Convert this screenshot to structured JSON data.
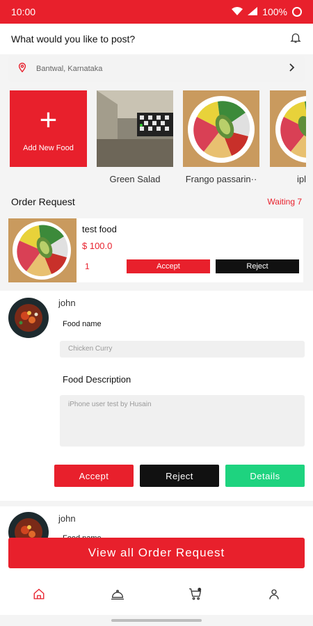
{
  "status_bar": {
    "time": "10:00",
    "battery": "100%"
  },
  "header": {
    "title": "What would you like to post?"
  },
  "location": {
    "text": "Bantwal, Karnataka"
  },
  "add_food": {
    "plus": "+",
    "label": "Add New Food"
  },
  "foods": [
    {
      "name": "Green Salad"
    },
    {
      "name": "Frango passarin··"
    },
    {
      "name": "ipl"
    }
  ],
  "order_section": {
    "title": "Order Request",
    "waiting": "Waiting 7"
  },
  "order": {
    "food_name": "test food",
    "price": "$ 100.0",
    "quantity": "1",
    "accept_label": "Accept",
    "reject_label": "Reject"
  },
  "requests": [
    {
      "user": "john",
      "food_name_label": "Food name",
      "food_name_value": "Chicken Curry",
      "desc_label": "Food Description",
      "desc_value": "iPhone user test by Husain",
      "accept_label": "Accept",
      "reject_label": "Reject",
      "details_label": "Details"
    },
    {
      "user": "john",
      "food_name_label": "Food name"
    }
  ],
  "view_all_label": "View all Order Request",
  "nav": [
    "home-icon",
    "cloche-icon",
    "cart-icon",
    "profile-icon"
  ],
  "colors": {
    "primary": "#e8202c",
    "dark": "#111111",
    "success": "#1ed37f"
  }
}
